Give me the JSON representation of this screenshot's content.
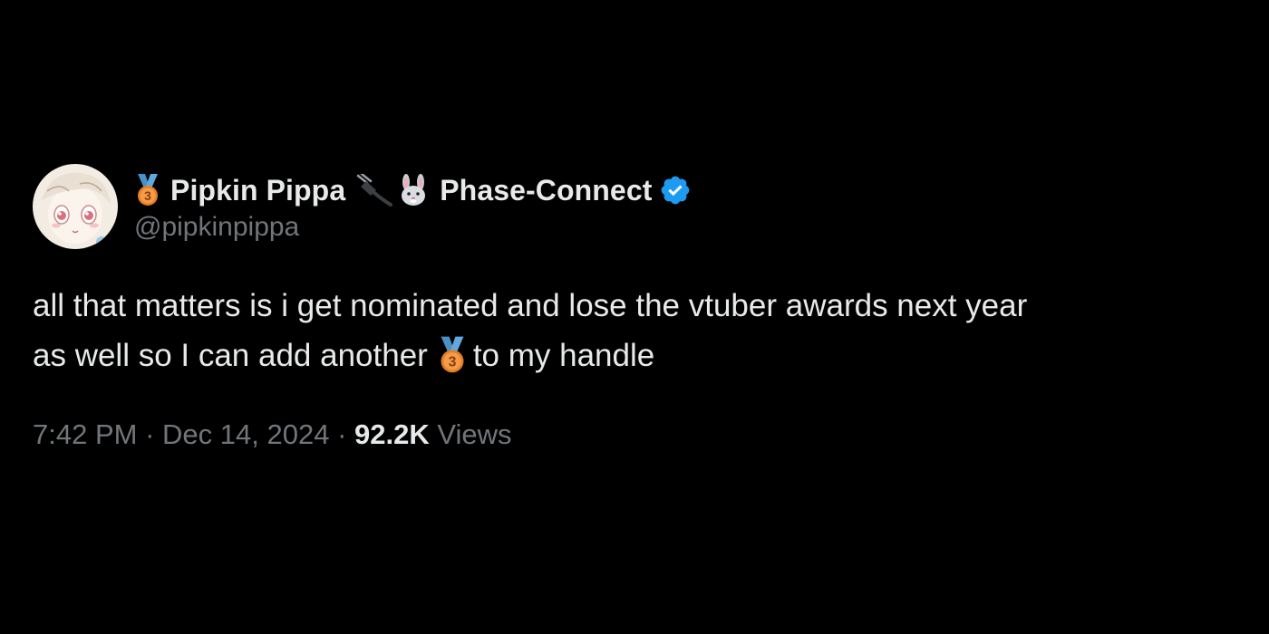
{
  "tweet": {
    "display_name_part1": "Pipkin Pippa",
    "display_name_part2": "Phase-Connect",
    "handle": "@pipkinpippa",
    "text_line1": "all that matters is i get nominated and lose the vtuber awards next year",
    "text_line2_before": "as well so I can add another",
    "text_line2_after": "to my handle",
    "time": "7:42 PM",
    "separator": "·",
    "date": "Dec 14, 2024",
    "views_count": "92.2K",
    "views_label": "Views"
  },
  "icons": {
    "medal": "third-place-medal-icon",
    "plug": "electric-plug-icon",
    "bunny": "rabbit-face-icon",
    "verified": "verified-badge-icon"
  },
  "colors": {
    "background": "#000000",
    "primary_text": "#e7e9ea",
    "secondary_text": "#71767b",
    "verified_blue": "#1d9bf0",
    "medal_orange": "#e67e22",
    "ribbon_blue": "#4a90c8"
  }
}
